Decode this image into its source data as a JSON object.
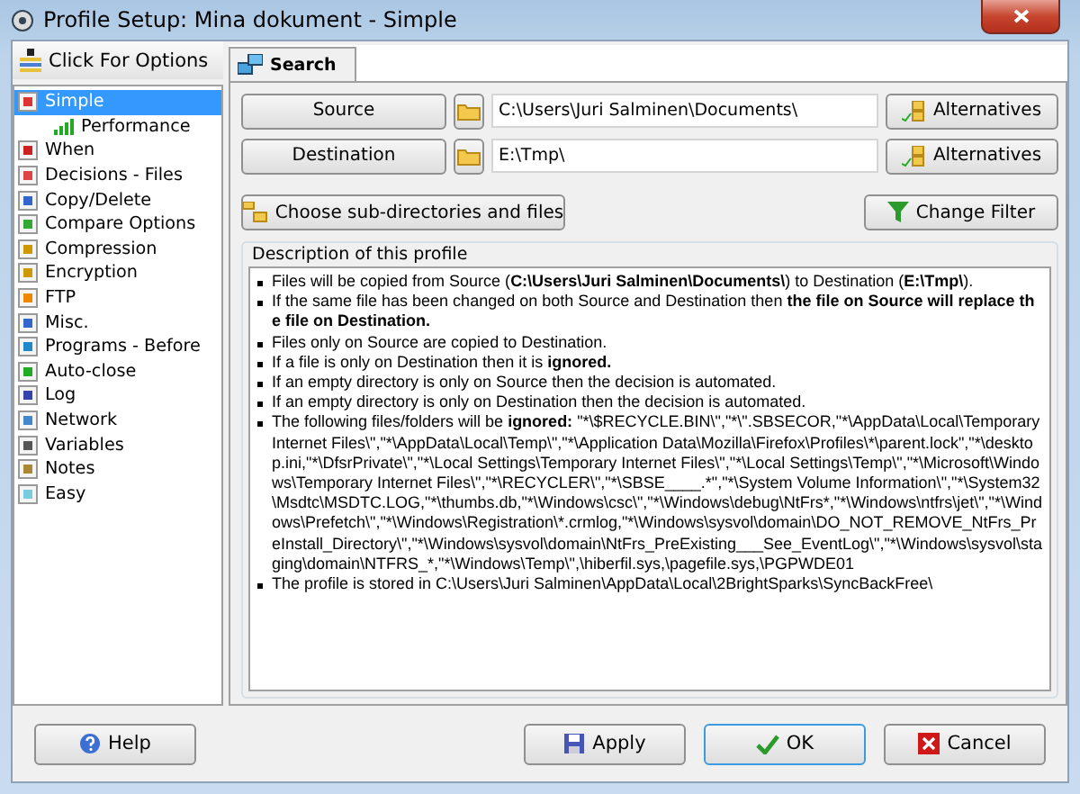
{
  "window": {
    "title": "Profile Setup: Mina dokument - Simple"
  },
  "sidebar": {
    "header": "Click For Options",
    "items": [
      {
        "label": "Simple",
        "selected": true,
        "children": [
          {
            "label": "Performance",
            "selected": false
          }
        ]
      },
      {
        "label": "When",
        "selected": false
      },
      {
        "label": "Decisions - Files",
        "selected": false
      },
      {
        "label": "Copy/Delete",
        "selected": false
      },
      {
        "label": "Compare Options",
        "selected": false
      },
      {
        "label": "Compression",
        "selected": false
      },
      {
        "label": "Encryption",
        "selected": false
      },
      {
        "label": "FTP",
        "selected": false
      },
      {
        "label": "Misc.",
        "selected": false
      },
      {
        "label": "Programs - Before",
        "selected": false
      },
      {
        "label": "Auto-close",
        "selected": false
      },
      {
        "label": "Log",
        "selected": false
      },
      {
        "label": "Network",
        "selected": false
      },
      {
        "label": "Variables",
        "selected": false
      },
      {
        "label": "Notes",
        "selected": false
      },
      {
        "label": "Easy",
        "selected": false
      }
    ]
  },
  "tabs": [
    {
      "label": "Search",
      "selected": true
    }
  ],
  "paths": [
    {
      "button": "Source",
      "value": "C:\\Users\\Juri Salminen\\Documents\\",
      "alternatives": "Alternatives"
    },
    {
      "button": "Destination",
      "value": "E:\\Tmp\\",
      "alternatives": "Alternatives"
    }
  ],
  "actions": {
    "choose": "Choose sub-directories and files",
    "filter": "Change Filter"
  },
  "description": {
    "title": "Description of this profile",
    "lines": [
      [
        {
          "text": "Files will be copied from Source (",
          "bold": false
        },
        {
          "text": "C:\\Users\\Juri Salminen\\Documents\\",
          "bold": true
        },
        {
          "text": ") to Destination (",
          "bold": false
        },
        {
          "text": "E:\\Tmp\\",
          "bold": true
        },
        {
          "text": ").",
          "bold": false
        }
      ],
      [
        {
          "text": "If the same file has been changed on both Source and Destination then ",
          "bold": false
        },
        {
          "text": "the file on Source will replace the file on Destination.",
          "bold": true
        }
      ],
      [
        {
          "text": "Files only on Source are copied to Destination.",
          "bold": false
        }
      ],
      [
        {
          "text": "If a file is only on Destination then it is ",
          "bold": false
        },
        {
          "text": "ignored.",
          "bold": true
        }
      ],
      [
        {
          "text": "If an empty directory is only on Source then the decision is automated.",
          "bold": false
        }
      ],
      [
        {
          "text": "If an empty directory is only on Destination then the decision is automated.",
          "bold": false
        }
      ],
      [
        {
          "text": "The following files/folders will be ",
          "bold": false
        },
        {
          "text": "ignored:",
          "bold": true
        },
        {
          "text": " \"*\\$RECYCLE.BIN\\\",\"*\\\".SBSECOR,\"*\\AppData\\Local\\Temporary Internet Files\\\",\"*\\AppData\\Local\\Temp\\\",\"*\\Application Data\\Mozilla\\Firefox\\Profiles\\*\\parent.lock\",\"*\\desktop.ini,\"*\\DfsrPrivate\\\",\"*\\Local Settings\\Temporary Internet Files\\\",\"*\\Local Settings\\Temp\\\",\"*\\Microsoft\\Windows\\Temporary Internet Files\\\",\"*\\RECYCLER\\\",\"*\\SBSE____.*\",\"*\\System Volume Information\\\",\"*\\System32\\Msdtc\\MSDTC.LOG,\"*\\thumbs.db,\"*\\Windows\\csc\\\",\"*\\Windows\\debug\\NtFrs*,\"*\\Windows\\ntfrs\\jet\\\",\"*\\Windows\\Prefetch\\\",\"*\\Windows\\Registration\\*.crmlog,\"*\\Windows\\sysvol\\domain\\DO_NOT_REMOVE_NtFrs_PreInstall_Directory\\\",\"*\\Windows\\sysvol\\domain\\NtFrs_PreExisting___See_EventLog\\\",\"*\\Windows\\sysvol\\staging\\domain\\NTFRS_*,\"*\\Windows\\Temp\\\",\\hiberfil.sys,\\pagefile.sys,\\PGPWDE01",
          "bold": false
        }
      ],
      [
        {
          "text": "The profile is stored in C:\\Users\\Juri Salminen\\AppData\\Local\\2BrightSparks\\SyncBackFree\\",
          "bold": false
        }
      ]
    ]
  },
  "buttons": [
    {
      "kind": "help",
      "label": "Help"
    },
    {
      "kind": "apply",
      "label": "Apply"
    },
    {
      "kind": "ok",
      "label": "OK"
    },
    {
      "kind": "cancel",
      "label": "Cancel"
    }
  ]
}
